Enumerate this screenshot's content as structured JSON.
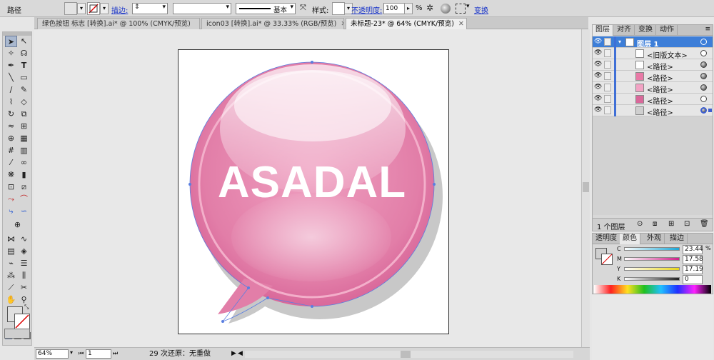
{
  "control_bar": {
    "object_type": "路径",
    "stroke_label": "描边:",
    "stroke_style": "基本",
    "style_label": "样式:",
    "opacity_label": "不透明度:",
    "opacity_value": "100",
    "opacity_unit": "%",
    "transform_label": "变换"
  },
  "doc_tabs": [
    {
      "label": "绿色按钮 标志 [转换].ai* @ 100% (CMYK/预览)"
    },
    {
      "label": "icon03 [转换].ai* @ 33.33% (RGB/预览)"
    },
    {
      "label": "未标题-23* @ 64% (CMYK/预览)"
    }
  ],
  "artwork": {
    "text": "ASADAL",
    "bubble_color": "#e879a6",
    "shadow_color": "#c8c8c8"
  },
  "status_bar": {
    "zoom": "64%",
    "page": "1",
    "status_text": "29 次还原：无重做"
  },
  "layers_panel": {
    "tabs": [
      "图层",
      "对齐",
      "变换",
      "动作"
    ],
    "rows": [
      {
        "name": "图层 1"
      },
      {
        "name": "<旧版文本>"
      },
      {
        "name": "<路径>"
      },
      {
        "name": "<路径>"
      },
      {
        "name": "<路径>"
      },
      {
        "name": "<路径>"
      },
      {
        "name": "<路径>"
      }
    ],
    "footer": "1 个图层"
  },
  "color_panel": {
    "tabs": [
      "透明度",
      "颜色",
      "外观",
      "描边"
    ],
    "channels": [
      {
        "name": "C",
        "value": "23.44"
      },
      {
        "name": "M",
        "value": "17.58"
      },
      {
        "name": "Y",
        "value": "17.19"
      },
      {
        "name": "K",
        "value": "0"
      }
    ],
    "channel_colors": [
      "#1aa8d8",
      "#d0208a",
      "#e8d61c",
      "#222222"
    ]
  },
  "icons": [
    "selection-tool-icon",
    "direct-selection-icon",
    "pen-icon",
    "type-icon",
    "eye-icon",
    "new-layer-icon",
    "trash-icon"
  ]
}
